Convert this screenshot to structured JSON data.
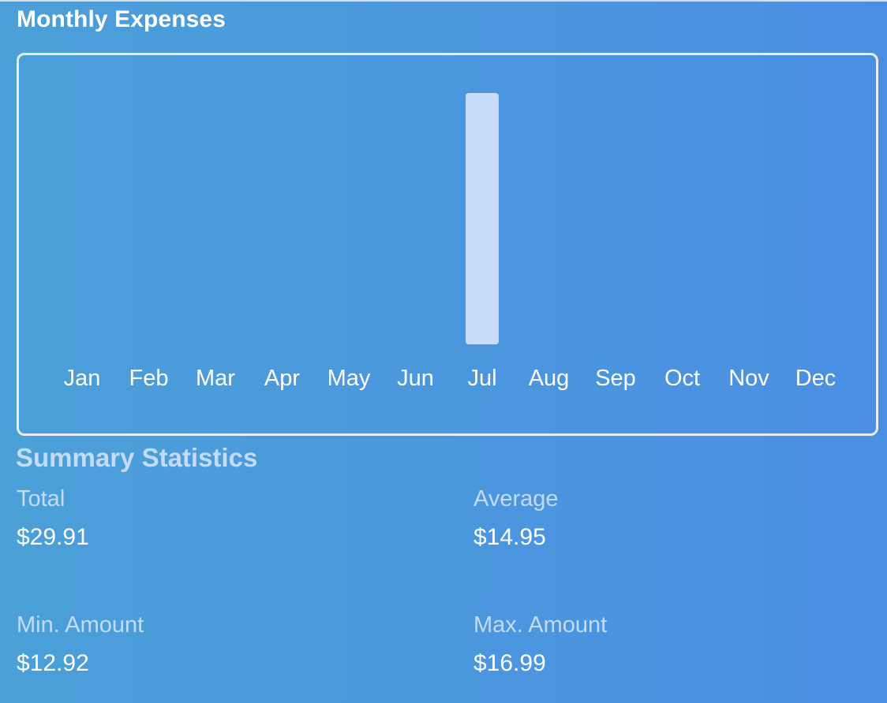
{
  "page": {
    "title": "Monthly Expenses"
  },
  "chart_data": {
    "type": "bar",
    "categories": [
      "Jan",
      "Feb",
      "Mar",
      "Apr",
      "May",
      "Jun",
      "Jul",
      "Aug",
      "Sep",
      "Oct",
      "Nov",
      "Dec"
    ],
    "values": [
      0,
      0,
      0,
      0,
      0,
      0,
      29.91,
      0,
      0,
      0,
      0,
      0
    ],
    "ylim": [
      0,
      29.91
    ],
    "grid": false,
    "bar_color": "#c7dcf8"
  },
  "summary": {
    "title": "Summary Statistics",
    "stats": [
      {
        "label": "Total",
        "value": "$29.91"
      },
      {
        "label": "Average",
        "value": "$14.95"
      },
      {
        "label": "Min. Amount",
        "value": "$12.92"
      },
      {
        "label": "Max. Amount",
        "value": "$16.99"
      }
    ]
  },
  "colors": {
    "background_start": "#4ba0d8",
    "background_end": "#4b8fe3",
    "label_muted": "#c4dbf8",
    "card_border": "#e8edf5"
  }
}
